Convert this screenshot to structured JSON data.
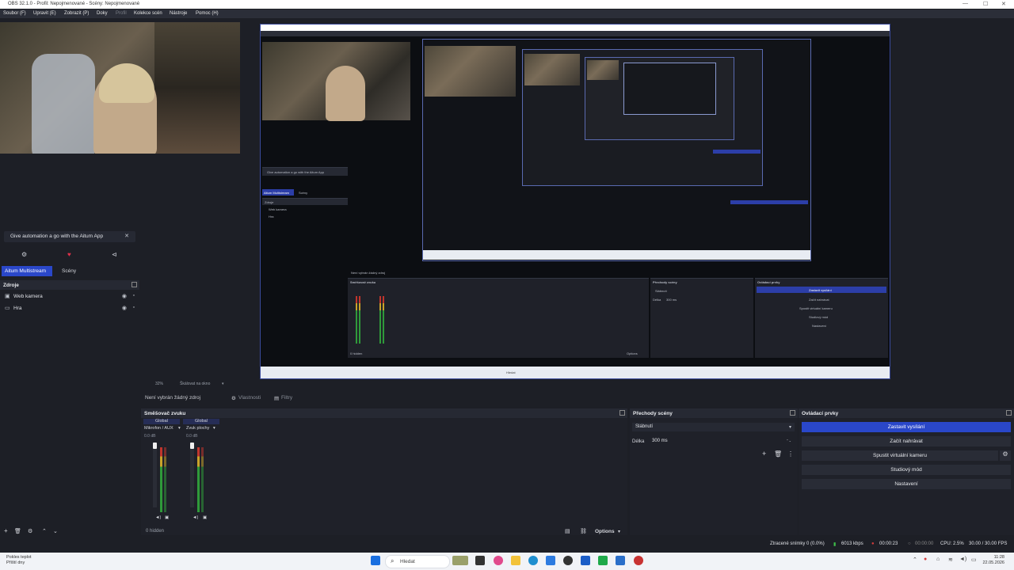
{
  "window": {
    "title": "OBS 32.1.0 - Profil: Nepojmenované - Scény: Nepojmenované",
    "controls": [
      "—",
      "☐",
      "✕"
    ]
  },
  "menu": [
    "Soubor (F)",
    "Upravit (E)",
    "Zobrazit (P)",
    "Doky",
    "Profil",
    "Kolekce scén",
    "Nástroje",
    "Pomoc (H)"
  ],
  "left": {
    "automation_text": "Give automation a go with the Aitum App",
    "automation_close": "✕",
    "icon_row": [
      "⚙",
      "♥",
      "⊲"
    ],
    "tabs": [
      "Aitum Multistream",
      "Scény"
    ],
    "sources_title": "Zdroje",
    "sources": [
      {
        "name": "Web kamera",
        "icon": "camera-icon"
      },
      {
        "name": "Hra",
        "icon": "monitor-icon"
      }
    ],
    "sources_footer": [
      "+",
      "🗑",
      "⚙",
      "⌃",
      "⌄"
    ]
  },
  "zoom": {
    "value": "32%",
    "label": "Škálovat na okno"
  },
  "source_toolbar": {
    "no_source": "Není vybrán žádný zdroj",
    "properties": "Vlastnosti",
    "filters": "Filtry"
  },
  "mixer": {
    "title": "Směšovač zvuku",
    "channels": [
      {
        "scope": "Global",
        "name": "Mikrofon / AUX",
        "db": "0.0 dB"
      },
      {
        "scope": "Global",
        "name": "Zvuk plochy",
        "db": "0.0 dB"
      }
    ],
    "scale": [
      "0",
      "-5",
      "-10",
      "-15",
      "-20",
      "-25",
      "-30",
      "-35",
      "-40",
      "-45",
      "-50",
      "-55",
      "-60"
    ],
    "hidden": "0 hidden",
    "options": "Options"
  },
  "transitions": {
    "title": "Přechody scény",
    "selected": "Slábnutí",
    "duration_label": "Délka",
    "duration_value": "300 ms"
  },
  "controls": {
    "title": "Ovládací prvky",
    "buttons": [
      "Zastavit vysílání",
      "Začít nahrávat",
      "Spustit virtuální kameru",
      "Studiový mód",
      "Nastavení"
    ]
  },
  "status": {
    "dropped": "Ztracené snímky 0 (0.0%)",
    "bitrate": "6013 kbps",
    "stream_time": "00:00:23",
    "rec_time": "00:00:00",
    "cpu": "CPU: 2.5%",
    "fps": "30.00 / 30.00 FPS"
  },
  "taskbar": {
    "weather_line1": "Pokles teplot",
    "weather_line2": "Příští dny",
    "search": "Hledat",
    "time": "11:28",
    "date": "22.05.2026"
  },
  "preview_inner": {
    "automation_text": "Give automation a go with the Aitum App",
    "tabs": [
      "Aitum Multistream",
      "Scény"
    ],
    "sources_title": "Zdroje",
    "sources": [
      "Web kamera",
      "Hra"
    ],
    "no_source": "Není vybrán žádný zdroj",
    "mixer_title": "Směšovač zvuku",
    "transitions_title": "Přechody scény",
    "controls_title": "Ovládací prvky",
    "transition_value": "Slábnutí",
    "duration_label": "Délka",
    "duration_value": "300 ms",
    "buttons": [
      "Zastavit vysílání",
      "Začít nahrávat",
      "Spustit virtuální kameru",
      "Studiový mód",
      "Nastavení"
    ],
    "options": "Options",
    "hidden": "0 hidden",
    "search": "Hledat"
  },
  "colors": {
    "accent": "#2a47c9",
    "panel": "#1f2129",
    "background": "#1d1f26"
  }
}
